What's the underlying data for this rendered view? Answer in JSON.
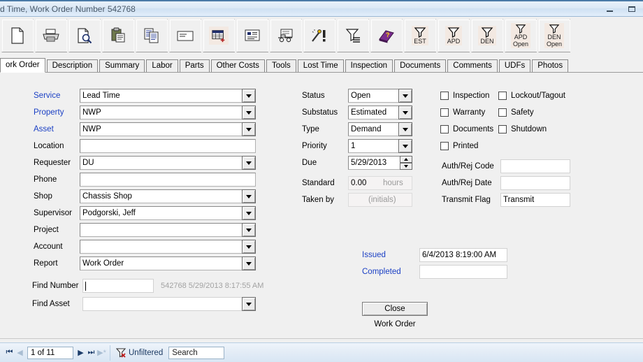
{
  "window": {
    "title": "d Time, Work Order Number 542768",
    "minimize_label": "Minimize",
    "restore_label": "Restore"
  },
  "toolbar": {
    "buttons": [
      {
        "name": "new-record",
        "icon": "page-icon",
        "label": ""
      },
      {
        "name": "print",
        "icon": "printer-icon",
        "label": ""
      },
      {
        "name": "print-preview",
        "icon": "page-magnifier-icon",
        "label": ""
      },
      {
        "name": "clipboard-paste",
        "icon": "clipboard-icon",
        "label": ""
      },
      {
        "name": "copy",
        "icon": "copy-pages-icon",
        "label": ""
      },
      {
        "name": "email",
        "icon": "envelope-icon",
        "label": ""
      },
      {
        "name": "add-record",
        "icon": "grid-plus-icon",
        "label": "",
        "tinted": true
      },
      {
        "name": "form-view",
        "icon": "form-card-icon",
        "label": ""
      },
      {
        "name": "vehicle",
        "icon": "truck-icon",
        "label": ""
      },
      {
        "name": "alert",
        "icon": "wand-alert-icon",
        "label": ""
      },
      {
        "name": "filter-list",
        "icon": "funnel-lines-icon",
        "label": ""
      },
      {
        "name": "help",
        "icon": "book-help-icon",
        "label": ""
      },
      {
        "name": "filter-est",
        "icon": "funnel-icon",
        "label": "EST",
        "tinted": true
      },
      {
        "name": "filter-apd",
        "icon": "funnel-icon",
        "label": "APD",
        "tinted": true
      },
      {
        "name": "filter-den",
        "icon": "funnel-icon",
        "label": "DEN",
        "tinted": true
      },
      {
        "name": "filter-apd-open",
        "icon": "funnel-icon",
        "label": "APD",
        "label2": "Open",
        "tinted": true
      },
      {
        "name": "filter-den-open",
        "icon": "funnel-icon",
        "label": "DEN",
        "label2": "Open",
        "tinted": true
      }
    ]
  },
  "tabs": [
    {
      "label": "ork Order",
      "active": true
    },
    {
      "label": "Description",
      "active": false
    },
    {
      "label": "Summary",
      "active": false
    },
    {
      "label": "Labor",
      "active": false
    },
    {
      "label": "Parts",
      "active": false
    },
    {
      "label": "Other Costs",
      "active": false
    },
    {
      "label": "Tools",
      "active": false
    },
    {
      "label": "Lost Time",
      "active": false
    },
    {
      "label": "Inspection",
      "active": false
    },
    {
      "label": "Documents",
      "active": false
    },
    {
      "label": "Comments",
      "active": false
    },
    {
      "label": "UDFs",
      "active": false
    },
    {
      "label": "Photos",
      "active": false
    }
  ],
  "left_column": [
    {
      "label": "Service",
      "value": "Lead Time",
      "link": true,
      "dropdown": true
    },
    {
      "label": "Property",
      "value": "NWP",
      "link": true,
      "dropdown": true
    },
    {
      "label": "Asset",
      "value": "NWP",
      "link": true,
      "dropdown": true
    },
    {
      "label": "Location",
      "value": "",
      "link": false,
      "dropdown": false
    },
    {
      "label": "Requester",
      "value": "DU",
      "link": false,
      "dropdown": true
    },
    {
      "label": "Phone",
      "value": "",
      "link": false,
      "dropdown": false
    },
    {
      "label": "Shop",
      "value": "Chassis Shop",
      "link": false,
      "dropdown": true
    },
    {
      "label": "Supervisor",
      "value": "Podgorski, Jeff",
      "link": false,
      "dropdown": true
    },
    {
      "label": "Project",
      "value": "",
      "link": false,
      "dropdown": true
    },
    {
      "label": "Account",
      "value": "",
      "link": false,
      "dropdown": true
    },
    {
      "label": "Report",
      "value": "Work Order",
      "link": false,
      "dropdown": true
    }
  ],
  "find": {
    "number_label": "Find Number",
    "number_value": "",
    "number_hint": "542768 5/29/2013 8:17:55 AM",
    "asset_label": "Find Asset",
    "asset_value": ""
  },
  "middle_column": [
    {
      "label": "Status",
      "value": "Open",
      "dropdown": true,
      "spinner": false
    },
    {
      "label": "Substatus",
      "value": "Estimated",
      "dropdown": true,
      "spinner": false
    },
    {
      "label": "Type",
      "value": "Demand",
      "dropdown": true,
      "spinner": false
    },
    {
      "label": "Priority",
      "value": "1",
      "dropdown": true,
      "spinner": false
    },
    {
      "label": "Due",
      "value": "5/29/2013",
      "dropdown": false,
      "spinner": true
    }
  ],
  "standard": {
    "label": "Standard",
    "value": "0.00",
    "unit": "hours"
  },
  "taken_by": {
    "label": "Taken by",
    "value": "",
    "placeholder": "(initials)"
  },
  "checkboxes": [
    {
      "label": "Inspection",
      "checked": false,
      "col": 0,
      "row": 0
    },
    {
      "label": "Lockout/Tagout",
      "checked": false,
      "col": 1,
      "row": 0
    },
    {
      "label": "Warranty",
      "checked": false,
      "col": 0,
      "row": 1
    },
    {
      "label": "Safety",
      "checked": false,
      "col": 1,
      "row": 1
    },
    {
      "label": "Documents",
      "checked": false,
      "col": 0,
      "row": 2
    },
    {
      "label": "Shutdown",
      "checked": false,
      "col": 1,
      "row": 2
    },
    {
      "label": "Printed",
      "checked": false,
      "col": 0,
      "row": 3
    }
  ],
  "auth_fields": [
    {
      "label": "Auth/Rej Code",
      "value": ""
    },
    {
      "label": "Auth/Rej Date",
      "value": ""
    },
    {
      "label": "Transmit Flag",
      "value": "Transmit"
    }
  ],
  "dates": [
    {
      "label": "Issued",
      "value": "6/4/2013 8:19:00 AM"
    },
    {
      "label": "Completed",
      "value": ""
    }
  ],
  "close_button": {
    "label": "Close",
    "caption": "Work Order"
  },
  "statusbar": {
    "record_text": "1 of 11",
    "filter_label": "Unfiltered",
    "search_value": "Search",
    "first_icon": "first-record-icon",
    "prev_icon": "previous-record-icon",
    "next_icon": "next-record-icon",
    "last_icon": "last-record-icon",
    "new_icon": "new-record-icon",
    "filter_icon": "filter-icon"
  },
  "colors": {
    "link": "#1a3fc4",
    "window_bg": "#f0f0f0",
    "titlebar": "#dce9f6",
    "accent": "#4a7aa7"
  }
}
